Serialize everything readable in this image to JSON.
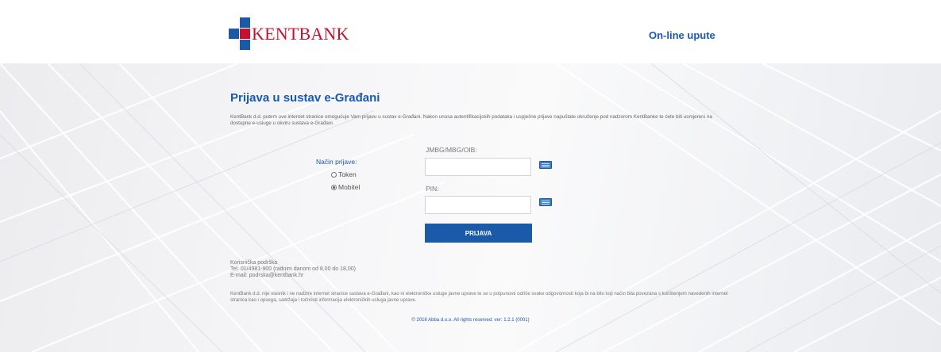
{
  "header": {
    "logo_text": "KENTBANK",
    "help_link": "On-line upute"
  },
  "colors": {
    "brand_blue": "#1a5aa8",
    "brand_red": "#c8102e"
  },
  "login": {
    "title": "Prijava u sustav e-Građani",
    "intro": "KentBank d.d. putem ove internet stranice omogućuje Vam prijavu u sustav e-Građani. Nakon unosa autentifikacijskih podataka i uspješne prijave napuštate okruženje pod nadzorom KentBanke te ćete biti usmjereni na dostupne e-usluge u okviru sustava e-Građani.",
    "method_label": "Način prijave:",
    "methods": [
      {
        "label": "Token",
        "selected": false
      },
      {
        "label": "Mobitel",
        "selected": true
      }
    ],
    "id_label": "JMBG/MBG/OIB:",
    "id_value": "",
    "pin_label": "PIN:",
    "pin_value": "",
    "keyboard_icon": "virtual-keyboard-icon",
    "submit_label": "PRIJAVA"
  },
  "support": {
    "title": "Korisnička podrška",
    "phone": "Tel: 01/4981-900 (radnim danom od 8,00 do 18,00)",
    "email": "E-mail: podrska@kentbank.hr"
  },
  "disclaimer": "KentBank d.d. nije vlasnik i ne nadzire internet stranice sustava e-Građani, kao ni elektroničke usluge javne uprave te se u potpunosti odriče svake odgovornosti koja bi na bilo koji način bila povezana s korištenjem navedenih internet stranica kao i opsega, sadržaja i točnosti informacija elektroničkih usluga javne uprave.",
  "footer": "© 2016 Abba d.o.o. All rights reserved. ver: 1.2.1 (0001)"
}
